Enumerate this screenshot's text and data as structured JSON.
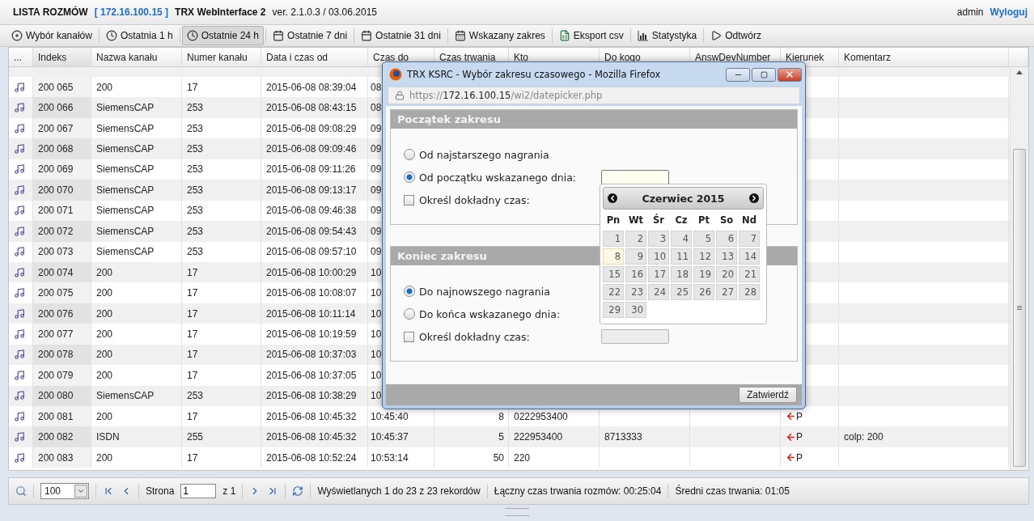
{
  "header": {
    "title": "LISTA ROZMÓW",
    "ip": "[ 172.16.100.15 ]",
    "app_name": "TRX WebInterface 2",
    "version": "ver. 2.1.0.3 / 03.06.2015",
    "user": "admin",
    "logout": "Wyloguj"
  },
  "toolbar": [
    {
      "label": "Wybór kanałów",
      "kind": "disc",
      "selected": false
    },
    {
      "label": "Ostatnia 1 h",
      "kind": "clock",
      "selected": false
    },
    {
      "label": "Ostatnie 24 h",
      "kind": "clock",
      "selected": true
    },
    {
      "label": "Ostatnie 7 dni",
      "kind": "calendar",
      "selected": false
    },
    {
      "label": "Ostatnie 31 dni",
      "kind": "calendar",
      "selected": false
    },
    {
      "label": "Wskazany zakres",
      "kind": "grid",
      "selected": false
    },
    {
      "label": "Eksport csv",
      "kind": "sheet",
      "selected": false
    },
    {
      "label": "Statystyka",
      "kind": "chart",
      "selected": false
    },
    {
      "label": "Odtwórz",
      "kind": "play",
      "selected": false
    }
  ],
  "columns": [
    "...",
    "Indeks",
    "Nazwa kanału",
    "Numer kanału",
    "Data i czas od",
    "Czas do",
    "Czas trwania",
    "Kto",
    "Do kogo",
    "AnswDevNumber",
    "Kierunek",
    "Komentarz"
  ],
  "rows": [
    {
      "indeks": "200 065",
      "nazwa": "200",
      "numer": "17",
      "data": "2015-06-08 08:39:04",
      "czas_do": "08"
    },
    {
      "indeks": "200 066",
      "nazwa": "SiemensCAP",
      "numer": "253",
      "data": "2015-06-08 08:43:15",
      "czas_do": "08"
    },
    {
      "indeks": "200 067",
      "nazwa": "SiemensCAP",
      "numer": "253",
      "data": "2015-06-08 09:08:29",
      "czas_do": "09"
    },
    {
      "indeks": "200 068",
      "nazwa": "SiemensCAP",
      "numer": "253",
      "data": "2015-06-08 09:09:46",
      "czas_do": "09"
    },
    {
      "indeks": "200 069",
      "nazwa": "SiemensCAP",
      "numer": "253",
      "data": "2015-06-08 09:11:26",
      "czas_do": "09"
    },
    {
      "indeks": "200 070",
      "nazwa": "SiemensCAP",
      "numer": "253",
      "data": "2015-06-08 09:13:17",
      "czas_do": "09"
    },
    {
      "indeks": "200 071",
      "nazwa": "SiemensCAP",
      "numer": "253",
      "data": "2015-06-08 09:46:38",
      "czas_do": "09"
    },
    {
      "indeks": "200 072",
      "nazwa": "SiemensCAP",
      "numer": "253",
      "data": "2015-06-08 09:54:43",
      "czas_do": "09"
    },
    {
      "indeks": "200 073",
      "nazwa": "SiemensCAP",
      "numer": "253",
      "data": "2015-06-08 09:57:10",
      "czas_do": "09"
    },
    {
      "indeks": "200 074",
      "nazwa": "200",
      "numer": "17",
      "data": "2015-06-08 10:00:29",
      "czas_do": "10"
    },
    {
      "indeks": "200 075",
      "nazwa": "200",
      "numer": "17",
      "data": "2015-06-08 10:08:07",
      "czas_do": "10"
    },
    {
      "indeks": "200 076",
      "nazwa": "200",
      "numer": "17",
      "data": "2015-06-08 10:11:14",
      "czas_do": "10"
    },
    {
      "indeks": "200 077",
      "nazwa": "200",
      "numer": "17",
      "data": "2015-06-08 10:19:59",
      "czas_do": "10"
    },
    {
      "indeks": "200 078",
      "nazwa": "200",
      "numer": "17",
      "data": "2015-06-08 10:37:03",
      "czas_do": "10"
    },
    {
      "indeks": "200 079",
      "nazwa": "200",
      "numer": "17",
      "data": "2015-06-08 10:37:05",
      "czas_do": "10"
    },
    {
      "indeks": "200 080",
      "nazwa": "SiemensCAP",
      "numer": "253",
      "data": "2015-06-08 10:38:29",
      "czas_do": "10"
    },
    {
      "indeks": "200 081",
      "nazwa": "200",
      "numer": "17",
      "data": "2015-06-08 10:45:32",
      "czas_do": "10:45:40",
      "czas_trwania": "8",
      "kto": "0222953400",
      "kierunek": "P"
    },
    {
      "indeks": "200 082",
      "nazwa": "ISDN",
      "numer": "255",
      "data": "2015-06-08 10:45:32",
      "czas_do": "10:45:37",
      "czas_trwania": "5",
      "kto": "222953400",
      "do_kogo": "8713333",
      "kierunek": "P",
      "komentarz": "colp: 200"
    },
    {
      "indeks": "200 083",
      "nazwa": "200",
      "numer": "17",
      "data": "2015-06-08 10:52:24",
      "czas_do": "10:53:14",
      "czas_trwania": "50",
      "kto": "220",
      "kierunek": "P"
    }
  ],
  "footer": {
    "page_size": "100",
    "page_label": "Strona",
    "page": "1",
    "page_of": "z 1",
    "display": "Wyświetlanych 1 do 23 z 23 rekordów",
    "total": "Łączny czas trwania rozmów: 00:25:04",
    "average": "Średni czas trwania: 01:05"
  },
  "popup": {
    "title": "TRX KSRC - Wybór zakresu czasowego - Mozilla Firefox",
    "url_scheme": "https://",
    "url_host": "172.16.100.15",
    "url_path": "/wi2/datepicker.php",
    "sections": [
      {
        "title": "Początek zakresu",
        "options": [
          {
            "kind": "radio",
            "label": "Od najstarszego nagrania",
            "selected": false
          },
          {
            "kind": "radio",
            "label": "Od początku wskazanego dnia:",
            "selected": true,
            "field": true,
            "focused": true
          },
          {
            "kind": "checkbox",
            "label": "Określ dokładny czas:",
            "checked": false
          }
        ]
      },
      {
        "title": "Koniec zakresu",
        "options": [
          {
            "kind": "radio",
            "label": "Do najnowszego nagrania",
            "selected": true
          },
          {
            "kind": "radio",
            "label": "Do końca wskazanego dnia:",
            "selected": false
          },
          {
            "kind": "checkbox",
            "label": "Określ dokładny czas:",
            "checked": false,
            "field": true,
            "focused": false
          }
        ]
      }
    ],
    "calendar": {
      "month": "Czerwiec 2015",
      "weekdays": [
        "Pn",
        "Wt",
        "Śr",
        "Cz",
        "Pt",
        "So",
        "Nd"
      ],
      "days": [
        {
          "label": "1",
          "today": false
        },
        {
          "label": "2",
          "today": false
        },
        {
          "label": "3",
          "today": false
        },
        {
          "label": "4",
          "today": false
        },
        {
          "label": "5",
          "today": false
        },
        {
          "label": "6",
          "today": false
        },
        {
          "label": "7",
          "today": false
        },
        {
          "label": "8",
          "today": true
        },
        {
          "label": "9",
          "today": false
        },
        {
          "label": "10",
          "today": false
        },
        {
          "label": "11",
          "today": false
        },
        {
          "label": "12",
          "today": false
        },
        {
          "label": "13",
          "today": false
        },
        {
          "label": "14",
          "today": false
        },
        {
          "label": "15",
          "today": false
        },
        {
          "label": "16",
          "today": false
        },
        {
          "label": "17",
          "today": false
        },
        {
          "label": "18",
          "today": false
        },
        {
          "label": "19",
          "today": false
        },
        {
          "label": "20",
          "today": false
        },
        {
          "label": "21",
          "today": false
        },
        {
          "label": "22",
          "today": false
        },
        {
          "label": "23",
          "today": false
        },
        {
          "label": "24",
          "today": false
        },
        {
          "label": "25",
          "today": false
        },
        {
          "label": "26",
          "today": false
        },
        {
          "label": "27",
          "today": false
        },
        {
          "label": "28",
          "today": false
        },
        {
          "label": "29",
          "today": false
        },
        {
          "label": "30",
          "today": false
        }
      ]
    },
    "submit": "Zatwierdź"
  }
}
